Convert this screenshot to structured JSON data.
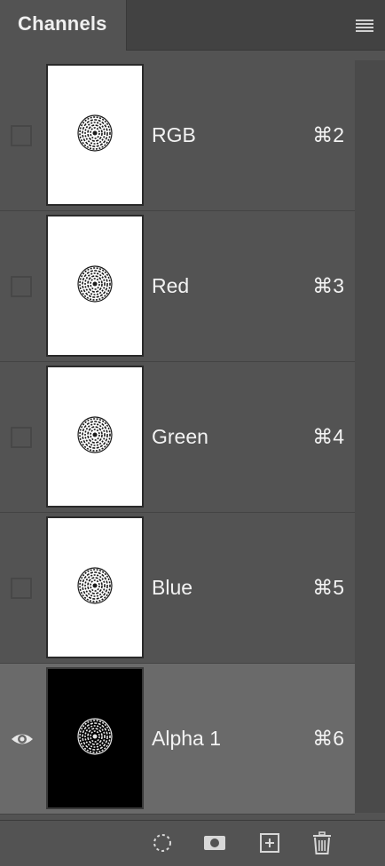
{
  "panel": {
    "tab_label": "Channels",
    "menu_icon": "hamburger-menu-icon"
  },
  "channels": [
    {
      "name": "RGB",
      "shortcut": "⌘2",
      "visible": false,
      "selected": false,
      "thumb": "white"
    },
    {
      "name": "Red",
      "shortcut": "⌘3",
      "visible": false,
      "selected": false,
      "thumb": "white"
    },
    {
      "name": "Green",
      "shortcut": "⌘4",
      "visible": false,
      "selected": false,
      "thumb": "white"
    },
    {
      "name": "Blue",
      "shortcut": "⌘5",
      "visible": false,
      "selected": false,
      "thumb": "white"
    },
    {
      "name": "Alpha 1",
      "shortcut": "⌘6",
      "visible": true,
      "selected": true,
      "thumb": "black"
    }
  ],
  "footer": {
    "buttons": [
      "load-selection-icon",
      "save-selection-mask-icon",
      "new-channel-icon",
      "delete-channel-icon"
    ]
  },
  "colors": {
    "panel_bg": "#535353",
    "selected_row": "#6a6a6a",
    "text": "#f2f2f2"
  }
}
